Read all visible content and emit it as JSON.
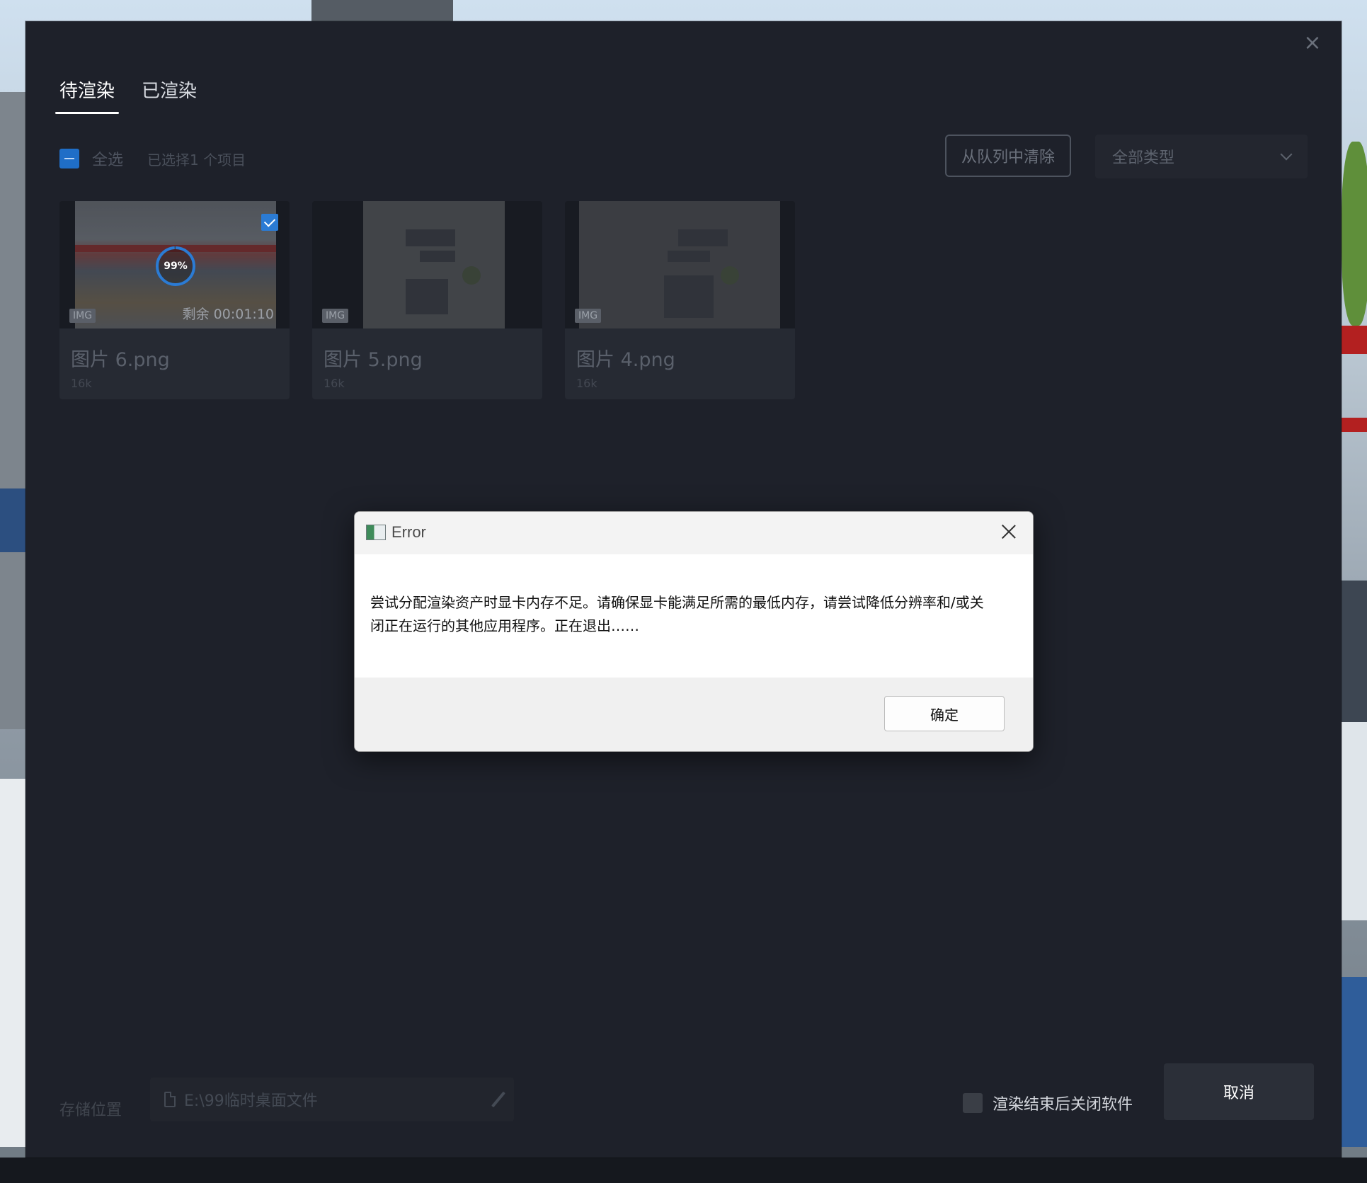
{
  "tabs": [
    {
      "label": "待渲染",
      "active": true
    },
    {
      "label": "已渲染",
      "active": false
    }
  ],
  "toolbar": {
    "select_all_label": "全选",
    "selected_count": "已选择1 个项目",
    "clear_button": "从队列中清除",
    "type_filter": "全部类型"
  },
  "cards": [
    {
      "name": "图片 6.png",
      "size": "16k",
      "tag": "IMG",
      "remaining": "剩余 00:01:10",
      "progress_label": "99%",
      "progress": 0.99,
      "checked": true
    },
    {
      "name": "图片 5.png",
      "size": "16k",
      "tag": "IMG"
    },
    {
      "name": "图片 4.png",
      "size": "16k",
      "tag": "IMG"
    }
  ],
  "footer": {
    "storage_label": "存储位置",
    "storage_path": "E:\\99临时桌面文件",
    "close_after_label": "渲染结束后关闭软件",
    "cancel_button": "取消"
  },
  "error_dialog": {
    "title": "Error",
    "message": "尝试分配渲染资产时显卡内存不足。请确保显卡能满足所需的最低内存，请尝试降低分辨率和/或关闭正在运行的其他应用程序。正在退出……",
    "ok_button": "确定"
  },
  "colors": {
    "panel_bg": "#1e212a",
    "accent": "#2b7bd4"
  }
}
